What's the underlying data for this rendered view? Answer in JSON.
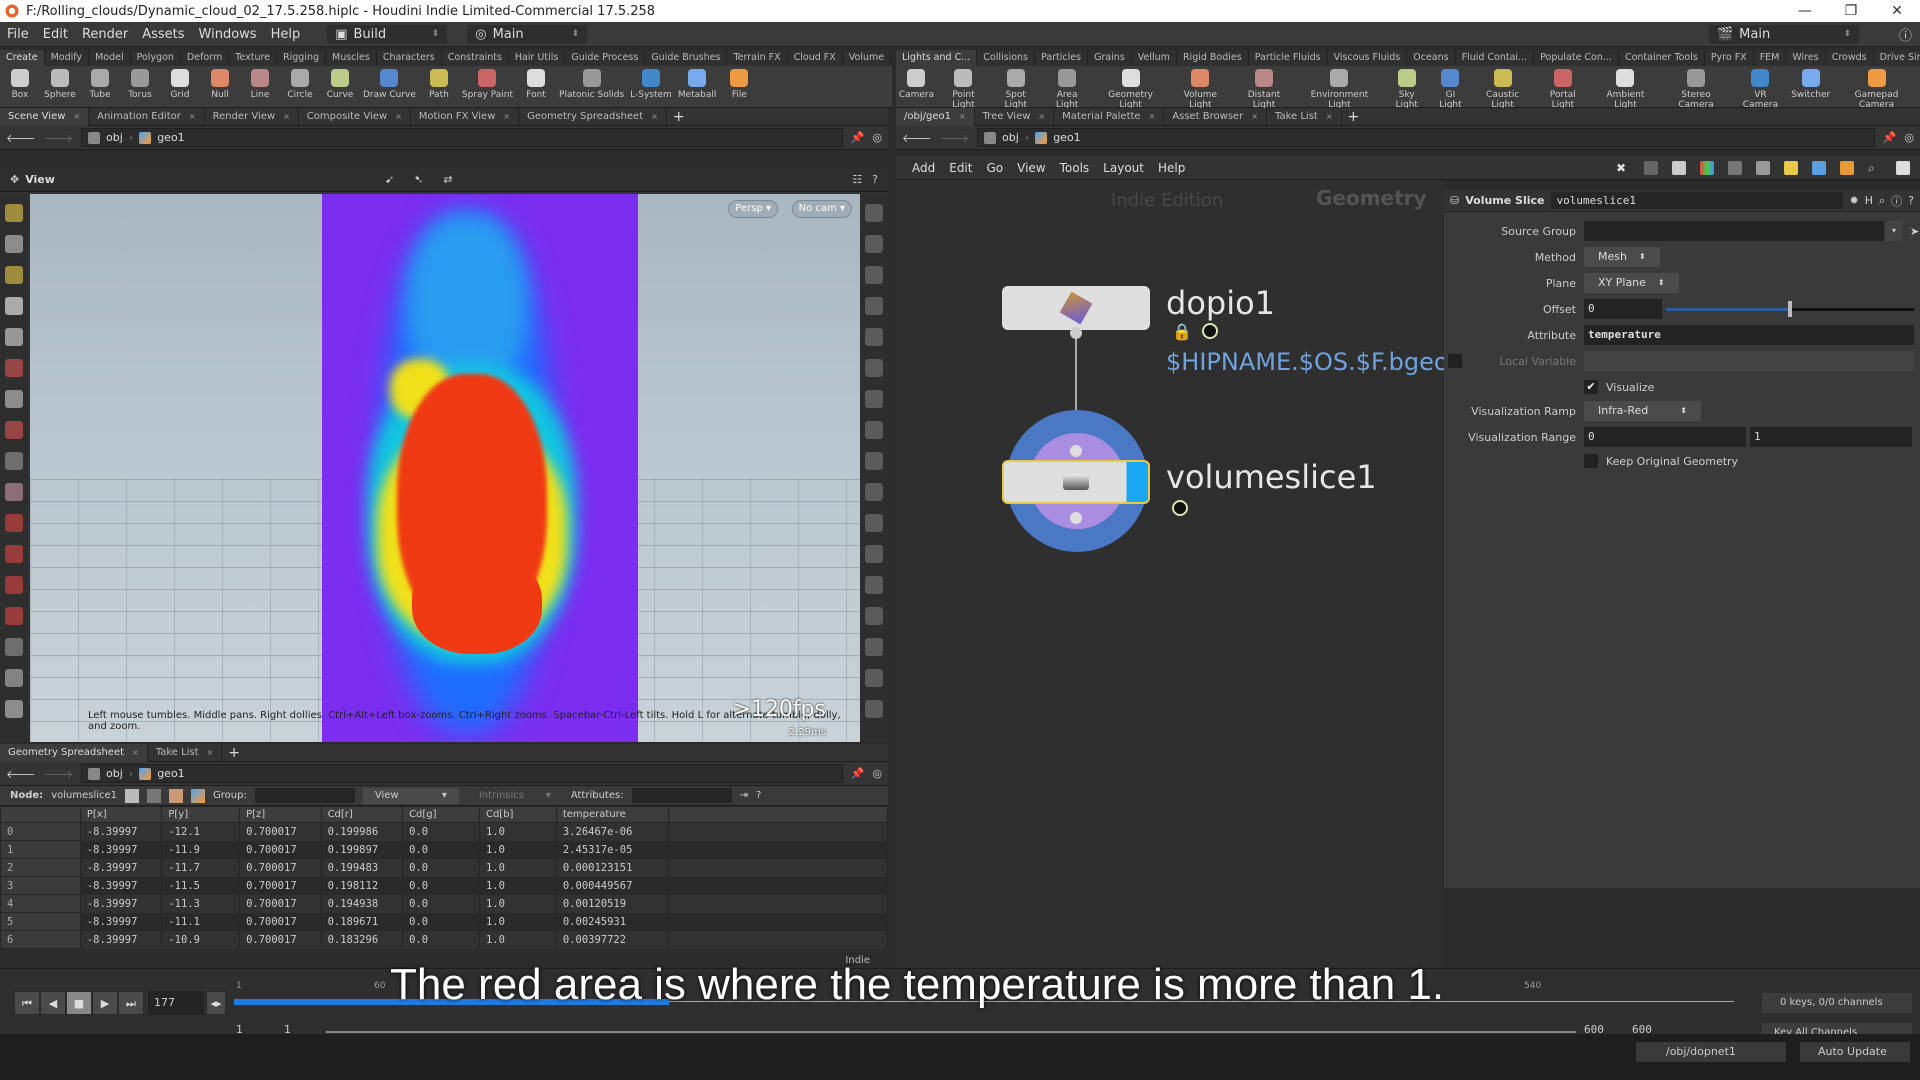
{
  "window": {
    "title": "F:/Rolling_clouds/Dynamic_cloud_02_17.5.258.hiplc - Houdini Indie Limited-Commercial 17.5.258",
    "controls": [
      "—",
      "❐",
      "✕"
    ]
  },
  "menubar": {
    "items": [
      "File",
      "Edit",
      "Render",
      "Assets",
      "Windows",
      "Help"
    ],
    "desktop": "Build",
    "main_layout": "Main",
    "right_layout": "Main"
  },
  "shelf_left": {
    "tabs": [
      "Create",
      "Modify",
      "Model",
      "Polygon",
      "Deform",
      "Texture",
      "Rigging",
      "Muscles",
      "Characters",
      "Constraints",
      "Hair Utils",
      "Guide Process",
      "Guide Brushes",
      "Terrain FX",
      "Cloud FX",
      "Volume"
    ],
    "active_tab": "Create",
    "tools": [
      "Box",
      "Sphere",
      "Tube",
      "Torus",
      "Grid",
      "Null",
      "Line",
      "Circle",
      "Curve",
      "Draw Curve",
      "Path",
      "Spray Paint",
      "Font",
      "Platonic Solids",
      "L-System",
      "Metaball",
      "File"
    ]
  },
  "shelf_right": {
    "tabs": [
      "Lights and C...",
      "Collisions",
      "Particles",
      "Grains",
      "Vellum",
      "Rigid Bodies",
      "Particle Fluids",
      "Viscous Fluids",
      "Oceans",
      "Fluid Contai...",
      "Populate Con...",
      "Container Tools",
      "Pyro FX",
      "FEM",
      "Wires",
      "Crowds",
      "Drive Simula..."
    ],
    "active_tab": "Lights and C...",
    "tools": [
      "Camera",
      "Point Light",
      "Spot Light",
      "Area Light",
      "Geometry Light",
      "Volume Light",
      "Distant Light",
      "Environment Light",
      "Sky Light",
      "GI Light",
      "Caustic Light",
      "Portal Light",
      "Ambient Light",
      "Stereo Camera",
      "VR Camera",
      "Switcher",
      "Gamepad Camera"
    ]
  },
  "left_pane": {
    "tabs": [
      "Scene View",
      "Animation Editor",
      "Render View",
      "Composite View",
      "Motion FX View",
      "Geometry Spreadsheet"
    ],
    "active_tab": "Scene View",
    "path": [
      "obj",
      "geo1"
    ]
  },
  "viewport": {
    "label": "View",
    "persp_button": "Persp ▾",
    "cam_button": "No cam ▾",
    "help_text": "Left mouse tumbles. Middle pans. Right dollies. Ctrl+Alt+Left box-zooms. Ctrl+Right zooms. Spacebar-Ctrl-Left tilts. Hold L for alternate tumble, dolly, and zoom.",
    "fps": ">120fps",
    "frame_time": "2.29ms"
  },
  "spreadsheet": {
    "tabs": [
      "Geometry Spreadsheet",
      "Take List"
    ],
    "path": [
      "obj",
      "geo1"
    ],
    "node_label": "Node:",
    "node_name": "volumeslice1",
    "group_label": "Group:",
    "view_label": "View",
    "intrinsics_label": "Intrinsics",
    "attributes_label": "Attributes:",
    "columns": [
      "",
      "P[x]",
      "P[y]",
      "P[z]",
      "Cd[r]",
      "Cd[g]",
      "Cd[b]",
      "temperature"
    ],
    "rows": [
      [
        "0",
        "-8.39997",
        "-12.1",
        "0.700017",
        "0.199986",
        "0.0",
        "1.0",
        "3.26467e-06"
      ],
      [
        "1",
        "-8.39997",
        "-11.9",
        "0.700017",
        "0.199897",
        "0.0",
        "1.0",
        "2.45317e-05"
      ],
      [
        "2",
        "-8.39997",
        "-11.7",
        "0.700017",
        "0.199483",
        "0.0",
        "1.0",
        "0.000123151"
      ],
      [
        "3",
        "-8.39997",
        "-11.5",
        "0.700017",
        "0.198112",
        "0.0",
        "1.0",
        "0.000449567"
      ],
      [
        "4",
        "-8.39997",
        "-11.3",
        "0.700017",
        "0.194938",
        "0.0",
        "1.0",
        "0.00120519"
      ],
      [
        "5",
        "-8.39997",
        "-11.1",
        "0.700017",
        "0.189671",
        "0.0",
        "1.0",
        "0.00245931"
      ],
      [
        "6",
        "-8.39997",
        "-10.9",
        "0.700017",
        "0.183296",
        "0.0",
        "1.0",
        "0.00397722"
      ]
    ],
    "edition_badge": "Indie"
  },
  "right_pane": {
    "tabs": [
      "/obj/geo1",
      "Tree View",
      "Material Palette",
      "Asset Browser",
      "Take List"
    ],
    "active_tab": "/obj/geo1",
    "path": [
      "obj",
      "geo1"
    ],
    "menu": [
      "Add",
      "Edit",
      "Go",
      "View",
      "Tools",
      "Layout",
      "Help"
    ],
    "edition_watermark": "Indie Edition",
    "context_label": "Geometry"
  },
  "network": {
    "nodes": [
      {
        "name": "dopio1",
        "comment": "$HIPNAME.$OS.$F.bgeo"
      },
      {
        "name": "volumeslice1",
        "comment": ""
      }
    ]
  },
  "params": {
    "node_type": "Volume Slice",
    "node_name": "volumeslice1",
    "source_group_label": "Source Group",
    "source_group": "",
    "method_label": "Method",
    "method": "Mesh",
    "plane_label": "Plane",
    "plane": "XY Plane",
    "offset_label": "Offset",
    "offset": "0",
    "offset_slider_fraction": 0.5,
    "attribute_label": "Attribute",
    "attribute": "temperature",
    "local_variable_label": "Local Variable",
    "visualize_label": "Visualize",
    "visualize": true,
    "ramp_label": "Visualization Ramp",
    "ramp": "Infra-Red",
    "range_label": "Visualization Range",
    "range_min": "0",
    "range_max": "1",
    "keep_original_label": "Keep Original Geometry"
  },
  "timeline": {
    "current_frame": "177",
    "start": "1",
    "start2": "1",
    "end": "600",
    "end2": "600",
    "ruler_labels": [
      "1",
      "60",
      "540"
    ],
    "keys_info": "0 keys, 0/0 channels",
    "key_mode": "Key All Channels",
    "playbar_fraction": 0.29
  },
  "statusbar": {
    "sim_path": "/obj/dopnet1",
    "update_mode": "Auto Update"
  },
  "overlay": {
    "subtitle": "The red area is where the temperature is more than 1."
  }
}
